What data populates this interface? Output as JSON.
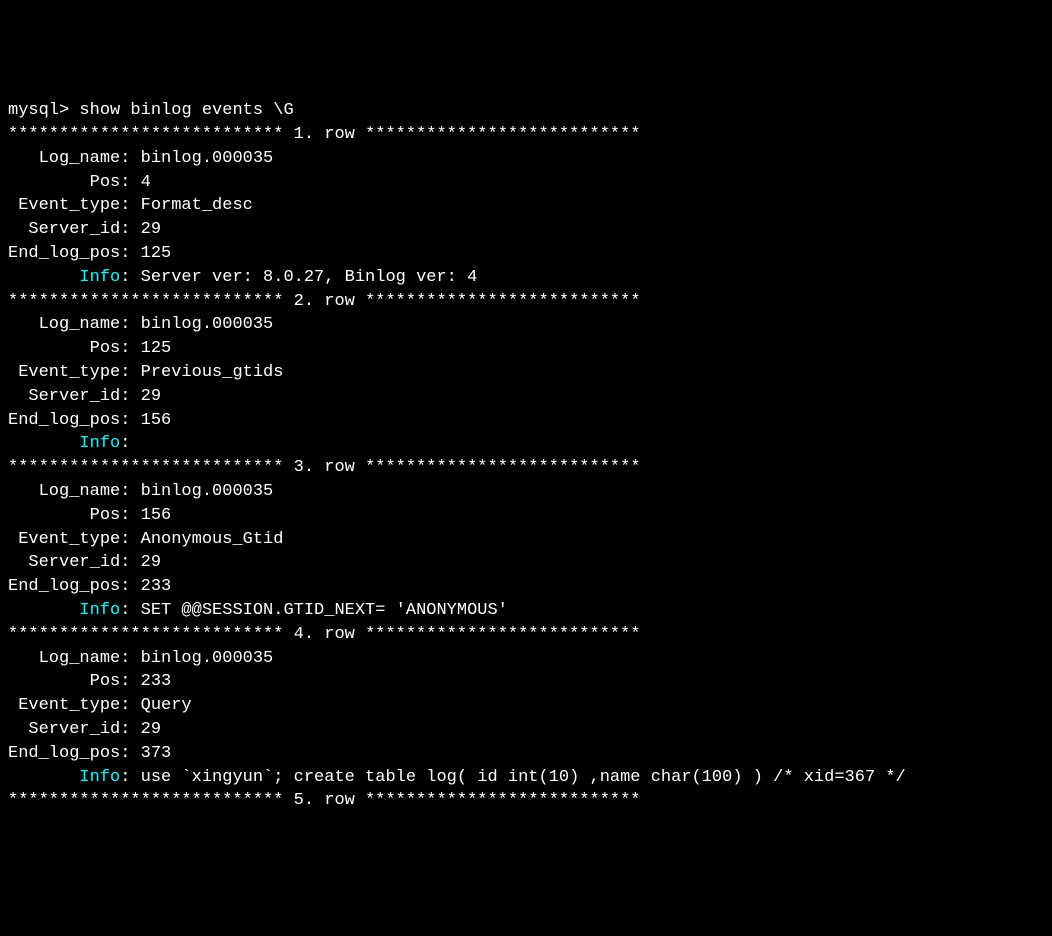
{
  "prompt": "mysql> ",
  "command": "show binlog events \\G",
  "row_sep_prefix": "*************************** ",
  "row_sep_suffix": ". row ***************************",
  "labels": {
    "log_name": "   Log_name:",
    "pos": "        Pos:",
    "event_type": " Event_type:",
    "server_id": "  Server_id:",
    "end_log_pos": "End_log_pos:",
    "info": "       Info"
  },
  "rows": [
    {
      "n": "1",
      "log_name": "binlog.000035",
      "pos": "4",
      "event_type": "Format_desc",
      "server_id": "29",
      "end_log_pos": "125",
      "info": "Server ver: 8.0.27, Binlog ver: 4"
    },
    {
      "n": "2",
      "log_name": "binlog.000035",
      "pos": "125",
      "event_type": "Previous_gtids",
      "server_id": "29",
      "end_log_pos": "156",
      "info": ""
    },
    {
      "n": "3",
      "log_name": "binlog.000035",
      "pos": "156",
      "event_type": "Anonymous_Gtid",
      "server_id": "29",
      "end_log_pos": "233",
      "info": "SET @@SESSION.GTID_NEXT= 'ANONYMOUS'"
    },
    {
      "n": "4",
      "log_name": "binlog.000035",
      "pos": "233",
      "event_type": "Query",
      "server_id": "29",
      "end_log_pos": "373",
      "info": "use `xingyun`; create table log( id int(10) ,name char(100) ) /* xid=367 */"
    }
  ],
  "partial_row_sep": "*************************** 5. row ***************************"
}
